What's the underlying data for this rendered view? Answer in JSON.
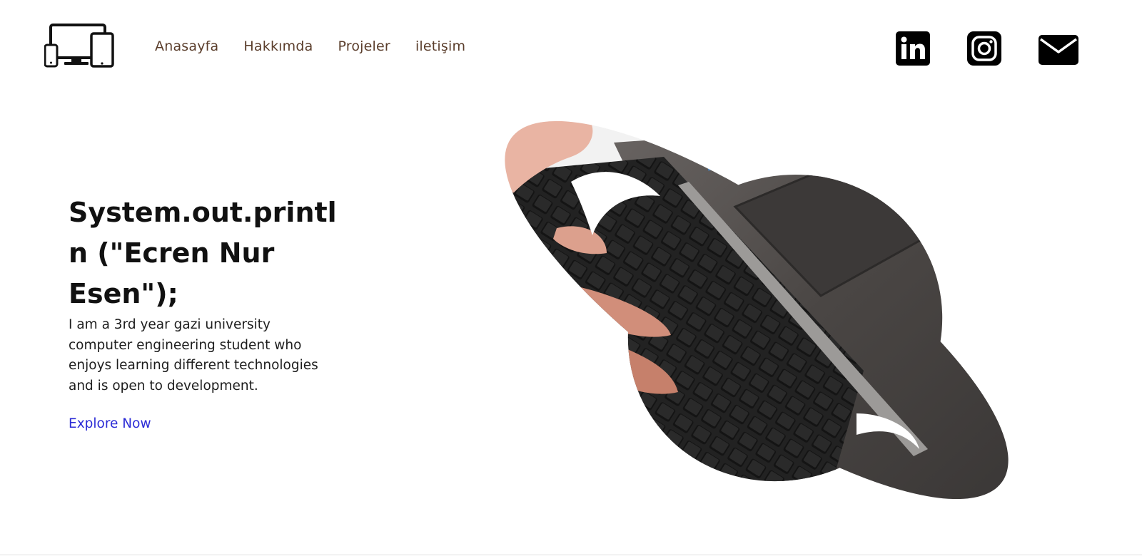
{
  "header": {
    "logo_icon": "devices-icon",
    "nav": [
      {
        "label": "Anasayfa"
      },
      {
        "label": "Hakkımda"
      },
      {
        "label": "Projeler"
      },
      {
        "label": "iletişim"
      }
    ],
    "social": [
      {
        "icon": "linkedin-icon"
      },
      {
        "icon": "instagram-icon"
      },
      {
        "icon": "mail-icon"
      }
    ]
  },
  "hero": {
    "title": "System.out.println (\"Ecren Nur Esen\");",
    "description": "I am a 3rd year gazi university computer engineering student who enjoys learning different technologies and is open to development.",
    "cta_label": "Explore Now",
    "image": "planet-shaped photo of hands typing on a laptop keyboard"
  },
  "colors": {
    "nav_text": "#5a3d2b",
    "link": "#2b2bd6",
    "heading": "#111111"
  }
}
